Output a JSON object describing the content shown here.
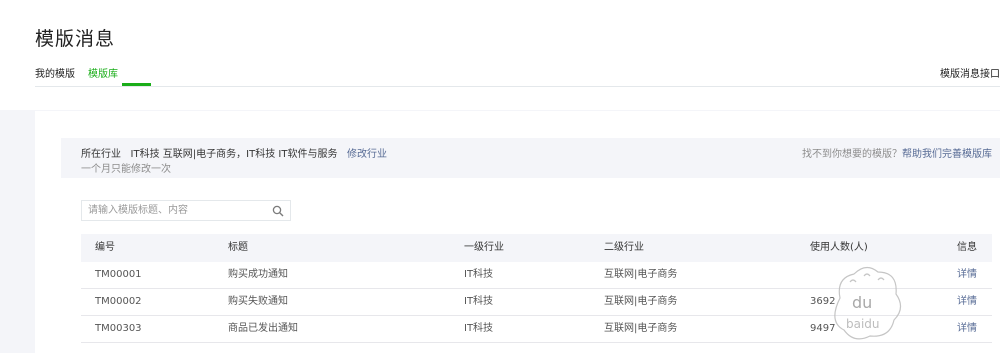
{
  "header": {
    "title": "模版消息"
  },
  "tabs": [
    {
      "label": "我的模版",
      "active": false
    },
    {
      "label": "模版库",
      "active": true
    }
  ],
  "tab_right_link": "模版消息接口",
  "industry": {
    "label": "所在行业",
    "value": "IT科技 互联网|电子商务，IT科技 IT软件与服务",
    "modify_link": "修改行业",
    "note": "一个月只能修改一次",
    "not_found_text": "找不到你想要的模版？",
    "help_link": "帮助我们完善模版库"
  },
  "search": {
    "placeholder": "请输入模版标题、内容",
    "value": ""
  },
  "table": {
    "columns": [
      "编号",
      "标题",
      "一级行业",
      "二级行业",
      "使用人数(人)",
      "信息"
    ],
    "rows": [
      {
        "id": "TM00001",
        "title": "购买成功通知",
        "industry1": "IT科技",
        "industry2": "互联网|电子商务",
        "users": "",
        "info": "详情"
      },
      {
        "id": "TM00002",
        "title": "购买失败通知",
        "industry1": "IT科技",
        "industry2": "互联网|电子商务",
        "users": "3692",
        "info": "详情"
      },
      {
        "id": "TM00303",
        "title": "商品已发出通知",
        "industry1": "IT科技",
        "industry2": "互联网|电子商务",
        "users": "9497",
        "info": "详情"
      }
    ]
  },
  "colors": {
    "accent": "#1aad19",
    "link": "#576b95",
    "bg": "#f4f5f9"
  },
  "icons": {
    "search": "search-icon",
    "watermark": "baidu-jingyan-watermark"
  },
  "watermark_text": [
    "du",
    "baidu"
  ]
}
